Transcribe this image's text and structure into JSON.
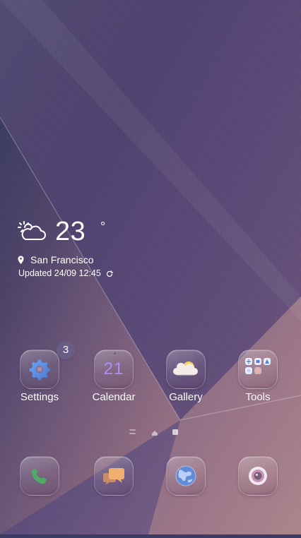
{
  "weather": {
    "temperature": "23",
    "degree_symbol": "°",
    "location": "San Francisco",
    "updated": "Updated 24/09 12:45",
    "icon": "partly-cloudy-icon"
  },
  "apps": [
    {
      "label": "Settings",
      "icon": "settings-icon",
      "badge": "3"
    },
    {
      "label": "Calendar",
      "icon": "calendar-icon",
      "date": "21"
    },
    {
      "label": "Gallery",
      "icon": "gallery-icon"
    },
    {
      "label": "Tools",
      "icon": "folder-icon"
    }
  ],
  "dock": [
    {
      "icon": "phone-icon"
    },
    {
      "icon": "messages-icon"
    },
    {
      "icon": "browser-icon"
    },
    {
      "icon": "camera-icon"
    }
  ],
  "page_indicators": [
    "menu-indicator-icon",
    "home-indicator-icon",
    "page-indicator-icon"
  ],
  "colors": {
    "calendar_accent": "#aa8ff5",
    "badge_background": "#676085"
  }
}
